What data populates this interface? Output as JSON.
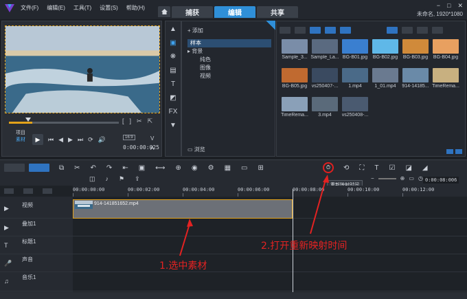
{
  "app": {
    "project_name": "未命名, 1920*1080",
    "menu": [
      "文件(F)",
      "编辑(E)",
      "工具(T)",
      "设置(S)",
      "帮助(H)"
    ],
    "tabs": [
      "捕获",
      "编辑",
      "共享"
    ],
    "active_tab": "编辑",
    "accent": "#2f8fd8"
  },
  "preview": {
    "mode_project": "项目",
    "mode_clip": "素材",
    "timecode": "0:00:00:025",
    "hd_badge": "16:9",
    "va_v": "V",
    "va_a": "A"
  },
  "library": {
    "add_label": "添加",
    "folders": [
      "样本",
      "背景",
      "纯色",
      "图像",
      "视频"
    ],
    "browse_label": "浏览",
    "media": [
      {
        "label": "Sample_3...",
        "color": "#7a8da8"
      },
      {
        "label": "Sample_La...",
        "color": "#5a6a80"
      },
      {
        "label": "BG-B01.jpg",
        "color": "#3a7fd0"
      },
      {
        "label": "BG-B02.jpg",
        "color": "#5fb8e8"
      },
      {
        "label": "BG-B03.jpg",
        "color": "#d08a3a"
      },
      {
        "label": "BG-B04.jpg",
        "color": "#e8a060"
      },
      {
        "label": "BG-B05.jpg",
        "color": "#c06a30"
      },
      {
        "label": "vs250407-...",
        "color": "#3a4a60"
      },
      {
        "label": "1.mp4",
        "color": "#4a6a88"
      },
      {
        "label": "1_01.mp4",
        "color": "#6a7a90"
      },
      {
        "label": "914-14185...",
        "color": "#6a8aa8"
      },
      {
        "label": "TimeRema...",
        "color": "#c8b080"
      },
      {
        "label": "TimeRema...",
        "color": "#8aa0b8"
      },
      {
        "label": "3.mp4",
        "color": "#5a6a7a"
      },
      {
        "label": "vs250408-...",
        "color": "#4a5a70"
      }
    ]
  },
  "toolbar": {
    "tooltip": "重新映射时间",
    "timecode": "0:00:08:006"
  },
  "timeline": {
    "ruler": [
      "00:00:00:00",
      "00:00:02:00",
      "00:00:04:00",
      "00:00:06:00",
      "00:00:08:00",
      "00:00:10:00",
      "00:00:12:00"
    ],
    "tracks": [
      "视频",
      "叠加1",
      "标题1",
      "声音",
      "音乐1"
    ],
    "clip_name": "914-141851652.mp4"
  },
  "annotations": {
    "step1": "1.选中素材",
    "step2": "2.打开重新映射时间",
    "color": "#e42222"
  }
}
